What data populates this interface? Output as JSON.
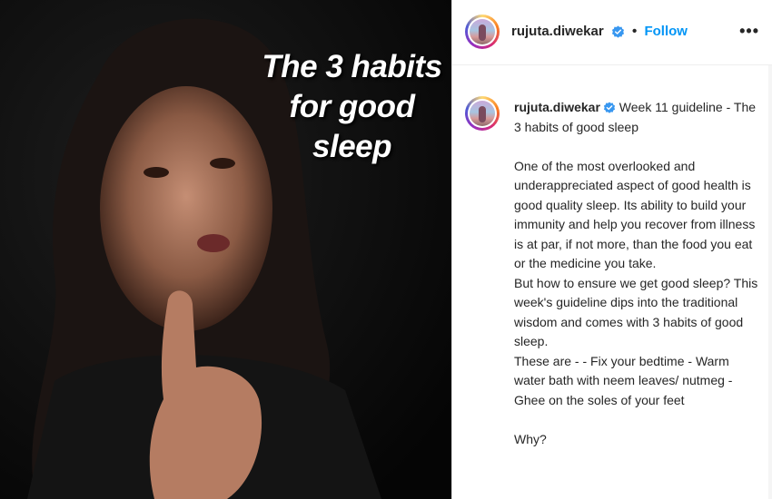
{
  "media": {
    "overlay_title": "The 3 habits\nfor good\nsleep"
  },
  "post": {
    "username": "rujuta.diwekar",
    "separator": "•",
    "follow_label": "Follow",
    "more_label": "•••"
  },
  "caption": {
    "username": "rujuta.diwekar",
    "text": " Week 11 guideline - The 3 habits of good sleep\n\nOne of the most overlooked and underappreciated aspect of good health is good quality sleep. Its ability to build your immunity and help you recover from illness is at par, if not more, than the food you eat or the medicine you take.\nBut how to ensure we get good sleep? This week's guideline dips into the traditional wisdom and comes with 3 habits of good sleep.\nThese are - - Fix your bedtime - Warm water bath with neem leaves/ nutmeg - Ghee on the soles of your feet\n\nWhy?"
  },
  "colors": {
    "follow": "#0095f6",
    "verified": "#3897f0",
    "text": "#262626"
  }
}
